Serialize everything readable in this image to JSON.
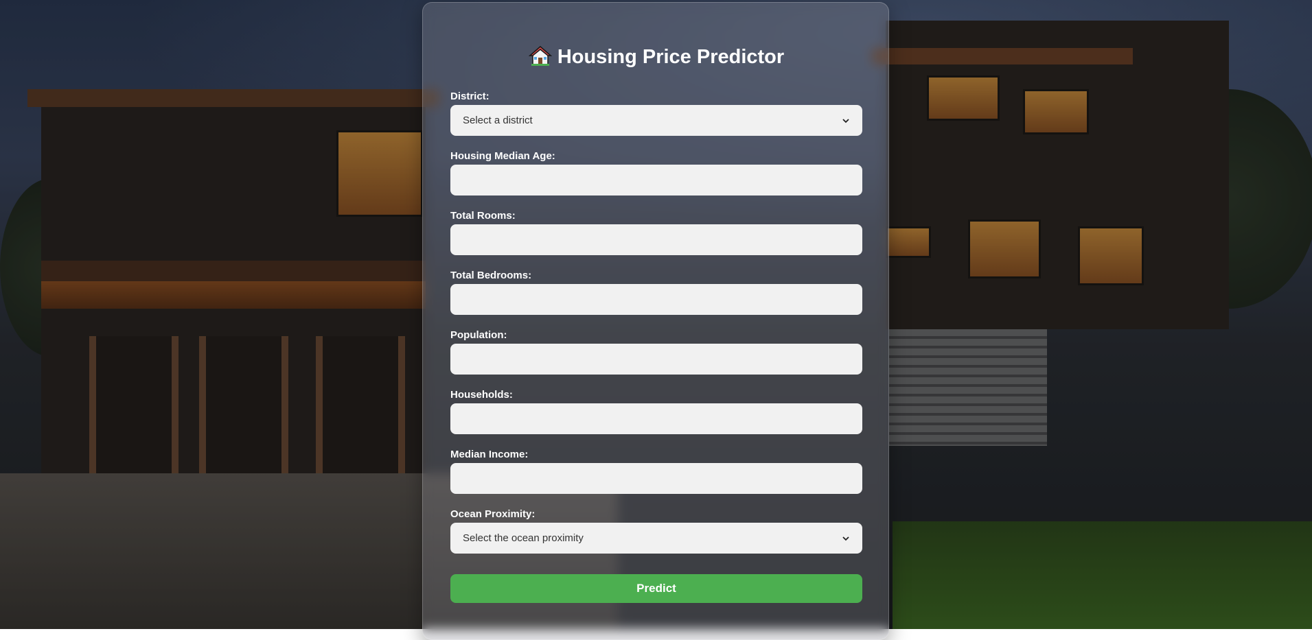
{
  "title": "Housing Price Predictor",
  "form": {
    "district": {
      "label": "District:",
      "placeholder": "Select a district"
    },
    "housing_median_age": {
      "label": "Housing Median Age:",
      "value": ""
    },
    "total_rooms": {
      "label": "Total Rooms:",
      "value": ""
    },
    "total_bedrooms": {
      "label": "Total Bedrooms:",
      "value": ""
    },
    "population": {
      "label": "Population:",
      "value": ""
    },
    "households": {
      "label": "Households:",
      "value": ""
    },
    "median_income": {
      "label": "Median Income:",
      "value": ""
    },
    "ocean_proximity": {
      "label": "Ocean Proximity:",
      "placeholder": "Select the ocean proximity"
    },
    "submit_label": "Predict"
  },
  "colors": {
    "accent": "#4caf50",
    "field_background": "#f1f1f1",
    "title_text": "#ffffff"
  },
  "icons": {
    "title_icon": "house-icon",
    "select_icon": "chevron-down-icon"
  }
}
